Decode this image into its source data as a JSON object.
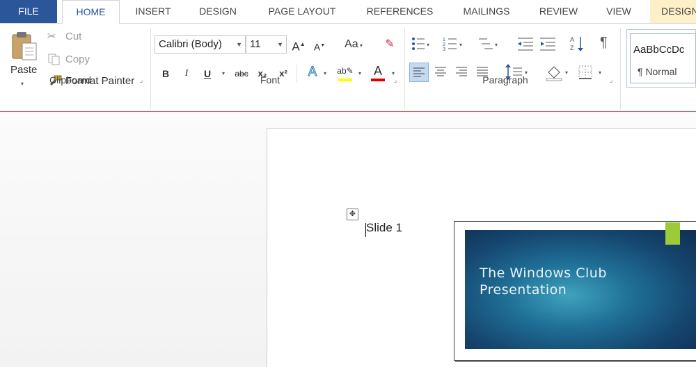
{
  "tabs": [
    "FILE",
    "HOME",
    "INSERT",
    "DESIGN",
    "PAGE LAYOUT",
    "REFERENCES",
    "MAILINGS",
    "REVIEW",
    "VIEW",
    "DESIGN"
  ],
  "clipboard": {
    "paste": "Paste",
    "cut": "Cut",
    "copy": "Copy",
    "format_painter": "Format Painter",
    "group_label": "Clipboard"
  },
  "font": {
    "family": "Calibri (Body)",
    "size": "11",
    "change_case": "Aa",
    "bold": "B",
    "italic": "I",
    "underline": "U",
    "strike": "abc",
    "subscript": "x₂",
    "superscript": "x²",
    "group_label": "Font"
  },
  "paragraph": {
    "group_label": "Paragraph",
    "pilcrow": "¶"
  },
  "styles": {
    "preview": "AaBbCcDc",
    "name": "¶ Normal"
  },
  "document": {
    "text": "Slide 1",
    "slide_title_line1": "The Windows Club",
    "slide_title_line2": "Presentation"
  },
  "colors": {
    "accent": "#2b579a",
    "highlight": "#ffff00",
    "font_color": "#e00000",
    "slide_accent": "#9bcb3b"
  }
}
